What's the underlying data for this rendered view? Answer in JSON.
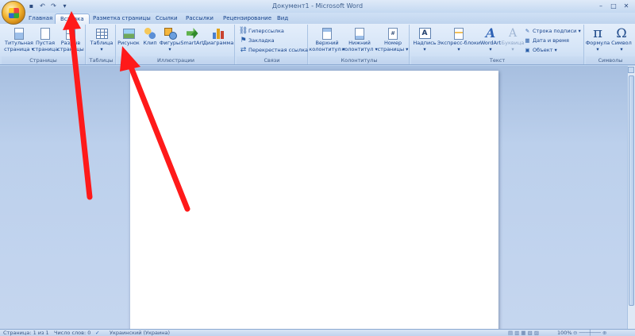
{
  "window": {
    "title": "Документ1 - Microsoft Word"
  },
  "quick_access": {
    "icons": [
      "save-icon",
      "undo-icon",
      "redo-icon",
      "customize-icon"
    ]
  },
  "tabs": [
    {
      "label": "Главная",
      "active": false
    },
    {
      "label": "Вставка",
      "active": true
    },
    {
      "label": "Разметка страницы",
      "active": false
    },
    {
      "label": "Ссылки",
      "active": false
    },
    {
      "label": "Рассылки",
      "active": false
    },
    {
      "label": "Рецензирование",
      "active": false
    },
    {
      "label": "Вид",
      "active": false
    }
  ],
  "ribbon": {
    "pages": {
      "label": "Страницы",
      "cover": "Титульная\nстраница ▾",
      "blank": "Пустая\nстраница",
      "break": "Разрыв\nстраницы"
    },
    "tables": {
      "label": "Таблицы",
      "table": "Таблица\n▾"
    },
    "illustrations": {
      "label": "Иллюстрации",
      "picture": "Рисунок",
      "clip": "Клип",
      "shapes": "Фигуры\n▾",
      "smartart": "SmartArt",
      "chart": "Диаграмма"
    },
    "links": {
      "label": "Связи",
      "hyperlink": "Гиперссылка",
      "bookmark": "Закладка",
      "cross_ref": "Перекрестная ссылка"
    },
    "header_footer": {
      "label": "Колонтитулы",
      "header": "Верхний\nколонтитул ▾",
      "footer": "Нижний\nколонтитул ▾",
      "page_number": "Номер\nстраницы ▾"
    },
    "text": {
      "label": "Текст",
      "textbox": "Надпись\n▾",
      "quick_parts": "Экспресс-блоки\n▾",
      "wordart": "WordArt\n▾",
      "dropcap": "Буквица\n▾",
      "signature": "Строка подписи ▾",
      "datetime": "Дата и время",
      "object": "Объект ▾"
    },
    "symbols": {
      "label": "Символы",
      "equation": "Формула\n▾",
      "symbol": "Символ\n▾"
    }
  },
  "statusbar": {
    "page": "Страница: 1 из 1",
    "words": "Число слов: 0",
    "language": "Украинский (Украина)",
    "zoom": "100%"
  },
  "colors": {
    "arrow": "#ff1a1a",
    "ribbon": "#dbe7f7"
  }
}
